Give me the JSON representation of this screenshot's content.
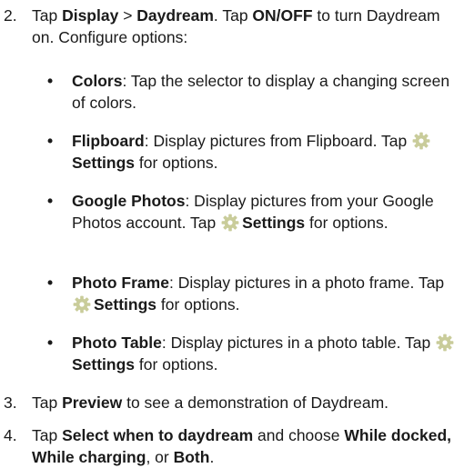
{
  "steps": [
    {
      "number": "2.",
      "parts": [
        {
          "t": "Tap "
        },
        {
          "t": "Display",
          "b": true
        },
        {
          "t": " > "
        },
        {
          "t": "Daydream",
          "b": true
        },
        {
          "t": ". Tap "
        },
        {
          "t": "ON/OFF",
          "b": true
        },
        {
          "t": " to turn Daydream on. Configure options:"
        }
      ]
    },
    {
      "number": "3.",
      "parts": [
        {
          "t": "Tap "
        },
        {
          "t": "Preview",
          "b": true
        },
        {
          "t": " to see a demonstration of Daydream."
        }
      ]
    },
    {
      "number": "4.",
      "parts": [
        {
          "t": "Tap "
        },
        {
          "t": "Select when to daydream",
          "b": true
        },
        {
          "t": " and choose "
        },
        {
          "t": "While docked, While charging",
          "b": true
        },
        {
          "t": ", or "
        },
        {
          "t": "Both",
          "b": true
        },
        {
          "t": "."
        }
      ]
    }
  ],
  "bullets": [
    {
      "parts": [
        {
          "t": "Colors",
          "b": true
        },
        {
          "t": ": Tap the selector to display a changing screen of colors."
        }
      ]
    },
    {
      "parts": [
        {
          "t": "Flipboard",
          "b": true
        },
        {
          "t": ": Display pictures from Flipboard. Tap "
        },
        {
          "icon": "settings-gear-icon"
        },
        {
          "t": "Settings",
          "b": true
        },
        {
          "t": " for options."
        }
      ]
    },
    {
      "parts": [
        {
          "t": "Google Photos",
          "b": true
        },
        {
          "t": ": Display pictures from your Google Photos account. Tap "
        },
        {
          "icon": "settings-gear-icon"
        },
        {
          "t": "Settings",
          "b": true
        },
        {
          "t": " for options."
        }
      ]
    },
    {
      "parts": [
        {
          "t": "Photo Frame",
          "b": true
        },
        {
          "t": ": Display pictures in a photo frame. Tap "
        },
        {
          "icon": "settings-gear-icon"
        },
        {
          "t": "Settings",
          "b": true
        },
        {
          "t": " for options."
        }
      ]
    },
    {
      "parts": [
        {
          "t": "Photo Table",
          "b": true
        },
        {
          "t": ": Display pictures in a photo table. Tap "
        },
        {
          "icon": "settings-gear-icon"
        },
        {
          "t": "Settings",
          "b": true
        },
        {
          "t": " for options."
        }
      ]
    }
  ],
  "bullet_glyph": "•",
  "colors": {
    "text": "#1a1a1a",
    "gear_fill": "#c9cc9a",
    "gear_center": "#ffffff"
  }
}
